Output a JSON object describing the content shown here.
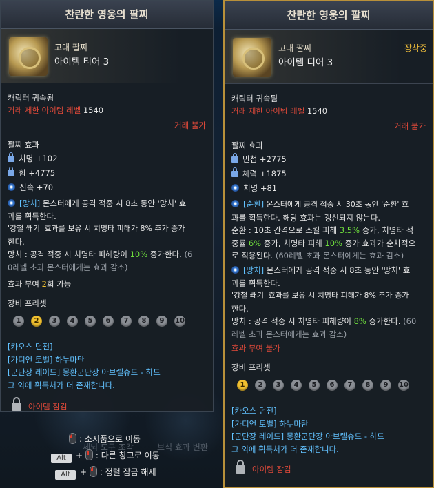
{
  "background": {
    "label_a": "세뇌 도구 조각",
    "label_b": "보석 효과 변환"
  },
  "left": {
    "title": "찬란한 영웅의 팔찌",
    "grade": "고대 팔찌",
    "tier": "아이템 티어 3",
    "bound": "캐릭터 귀속됨",
    "level_label": "거래 제한 아이템 레벨",
    "level_value": "1540",
    "trade": "거래 불가",
    "effect_title": "팔찌 효과",
    "stats": [
      {
        "icon": "lock-icon",
        "text": "치명 +102"
      },
      {
        "icon": "lock-icon",
        "text": "힘 +4775"
      },
      {
        "icon": "swirl-icon",
        "text": "신속 +70"
      }
    ],
    "effect": {
      "tag": "[망치]",
      "l1": " 몬스터에게 공격 적중 시 8초 동안 '망치' 효",
      "l2": "과를 획득한다.",
      "l3": "'강철 쐐기' 효과를 보유 시 치명타 피해가 8% 추가 증가",
      "l4": "한다.",
      "l5a": "망치 : 공격 적중 시 치명타 피해량이 ",
      "l5b": "10%",
      "l5c": " 증가한다. ",
      "l5d": "(6",
      "l6": "0레벨 초과 몬스터에게는 효과 감소)"
    },
    "enchant_a": "효과 부여 ",
    "enchant_b": "2",
    "enchant_c": "회 가능",
    "preset_title": "장비 프리셋",
    "presets": [
      "1",
      "2",
      "3",
      "4",
      "5",
      "6",
      "7",
      "8",
      "9",
      "10"
    ],
    "preset_active": "2",
    "sources": [
      "[카오스 던전]",
      "[가디언 토벌] 하누마탄",
      "[군단장 레이드] 몽환군단장 아브렐슈드 - 하드",
      "그 외에 획득처가 더 존재합니다."
    ],
    "locked": "아이템 잠김"
  },
  "hints": {
    "h1": ": 소지품으로 이동",
    "h2": ": 다른 창고로 이동",
    "h3": ": 정렬 잠금 해제",
    "alt": "Alt",
    "plus": "+"
  },
  "right": {
    "title": "찬란한 영웅의 팔찌",
    "grade": "고대 팔찌",
    "tier": "아이템 티어 3",
    "equipped": "장착중",
    "bound": "캐릭터 귀속됨",
    "level_label": "거래 제한 아이템 레벨",
    "level_value": "1540",
    "trade": "거래 불가",
    "effect_title": "팔찌 효과",
    "stats": [
      {
        "icon": "lock-icon",
        "text": "민첩 +2775"
      },
      {
        "icon": "lock-icon",
        "text": "체력 +1875"
      },
      {
        "icon": "swirl-icon",
        "text": "치명 +81"
      }
    ],
    "effect1": {
      "tag": "[순환]",
      "l1": " 몬스터에게 공격 적중 시 30초 동안 '순환' 효",
      "l2": "과를 획득한다. 해당 효과는 갱신되지 않는다.",
      "l3a": "순환 : 10초 간격으로 스킬 피해 ",
      "l3b": "3.5%",
      "l3c": " 증가, 치명타 적",
      "l4a": "중률 ",
      "l4b": "6%",
      "l4c": " 증가, 치명타 피해 ",
      "l4d": "10%",
      "l4e": " 증가 효과가 순차적으",
      "l5a": "로 적용된다. ",
      "l5b": "(60레벨 초과 몬스터에게는 효과 감소)"
    },
    "effect2": {
      "tag": "[망치]",
      "l1": " 몬스터에게 공격 적중 시 8초 동안 '망치' 효",
      "l2": "과를 획득한다.",
      "l3": "'강철 쐐기' 효과를 보유 시 치명타 피해가 8% 추가 증가",
      "l4": "한다.",
      "l5a": "망치 : 공격 적중 시 치명타 피해량이 ",
      "l5b": "8%",
      "l5c": " 증가한다. ",
      "l5d": "(60",
      "l6": "레벨 초과 몬스터에게는 효과 감소)"
    },
    "enchant": "효과 부여 불가",
    "preset_title": "장비 프리셋",
    "presets": [
      "1",
      "2",
      "3",
      "4",
      "5",
      "6",
      "7",
      "8",
      "9",
      "10"
    ],
    "preset_active": "1",
    "sources": [
      "[카오스 던전]",
      "[가디언 토벌] 하누마탄",
      "[군단장 레이드] 몽환군단장 아브렐슈드 - 하드",
      "그 외에 획득처가 더 존재합니다."
    ],
    "locked": "아이템 잠김"
  }
}
